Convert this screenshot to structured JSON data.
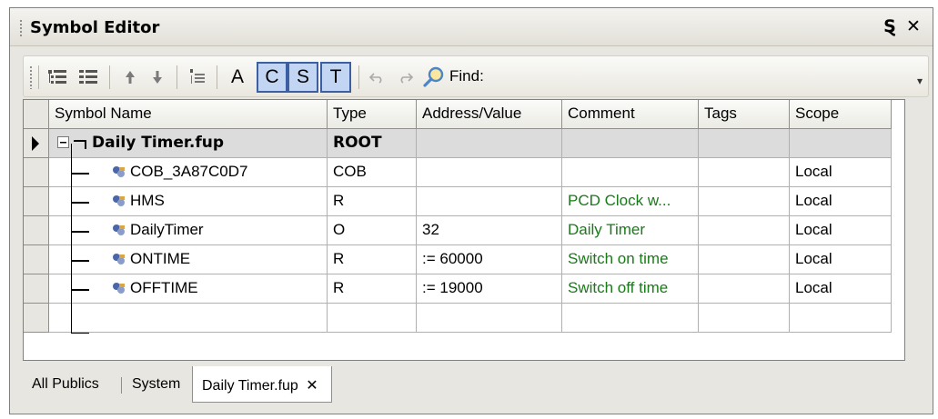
{
  "window": {
    "title": "Symbol Editor",
    "pin_glyph": "Ȿ",
    "close_glyph": "✕"
  },
  "toolbar": {
    "letter_a": "A",
    "letter_c": "C",
    "letter_s": "S",
    "letter_t": "T",
    "find_label": "Find:",
    "overflow_glyph": "▾"
  },
  "grid": {
    "columns": [
      "Symbol Name",
      "Type",
      "Address/Value",
      "Comment",
      "Tags",
      "Scope"
    ],
    "root": {
      "name": "Daily Timer.fup",
      "type": "ROOT"
    },
    "rows": [
      {
        "name": "COB_3A87C0D7",
        "type": "COB",
        "value": "",
        "comment": "",
        "tags": "",
        "scope": "Local"
      },
      {
        "name": "HMS",
        "type": "R",
        "value": "",
        "comment": "PCD Clock w...",
        "tags": "",
        "scope": "Local"
      },
      {
        "name": "DailyTimer",
        "type": "O",
        "value": "32",
        "comment": "Daily Timer",
        "tags": "",
        "scope": "Local"
      },
      {
        "name": "ONTIME",
        "type": "R",
        "value": " := 60000",
        "comment": "Switch on time",
        "tags": "",
        "scope": "Local"
      },
      {
        "name": "OFFTIME",
        "type": "R",
        "value": " := 19000",
        "comment": "Switch off time",
        "tags": "",
        "scope": "Local"
      }
    ]
  },
  "tabs": {
    "all_publics": "All Publics",
    "system": "System",
    "daily_timer": "Daily Timer.fup",
    "close_glyph": "✕"
  },
  "colors": {
    "comment_green": "#1a7a1a",
    "toggle_active_bg": "#c2d5f2",
    "toggle_active_border": "#3b5fa0"
  }
}
